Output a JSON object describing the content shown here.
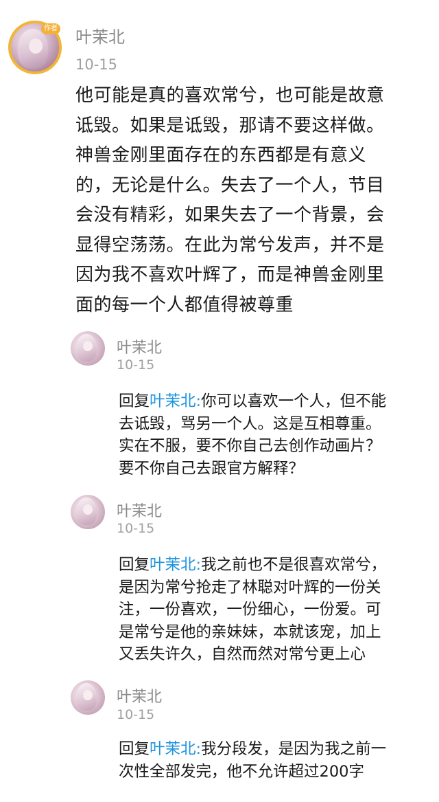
{
  "main_comment": {
    "username": "叶茉北",
    "badge": "作者",
    "date": "10-15",
    "lines": [
      "他可能是真的喜欢常兮，也可能是故意",
      "诋毁。如果是诋毁，那请不要这样做。",
      "神兽金刚里面存在的东西都是有意义",
      "的，无论是什么。失去了一个人，节目",
      "会没有精彩，如果失去了一个背景，会",
      "显得空荡荡。在此为常兮发声，并不是",
      "因为我不喜欢叶辉了，而是神兽金刚里",
      "面的每一个人都值得被尊重"
    ]
  },
  "replies": [
    {
      "username": "叶茉北",
      "date": "10-15",
      "reply_prefix": "回复",
      "mention": "叶茉北:",
      "lines": [
        "你可以喜欢一个人，但不能",
        "去诋毁，骂另一个人。这是互相尊重。",
        "实在不服，要不你自己去创作动画片？",
        "要不你自己去跟官方解释？"
      ]
    },
    {
      "username": "叶茉北",
      "date": "10-15",
      "reply_prefix": "回复",
      "mention": "叶茉北:",
      "lines": [
        "我之前也不是很喜欢常兮，",
        "是因为常兮抢走了林聪对叶辉的一份关",
        "注，一份喜欢，一份细心，一份爱。可",
        "是常兮是他的亲妹妹，本就该宠，加上",
        "又丢失许久，自然而然对常兮更上心"
      ]
    },
    {
      "username": "叶茉北",
      "date": "10-15",
      "reply_prefix": "回复",
      "mention": "叶茉北:",
      "lines": [
        "我分段发，是因为我之前一",
        "次性全部发完，他不允许超过200字"
      ]
    }
  ]
}
